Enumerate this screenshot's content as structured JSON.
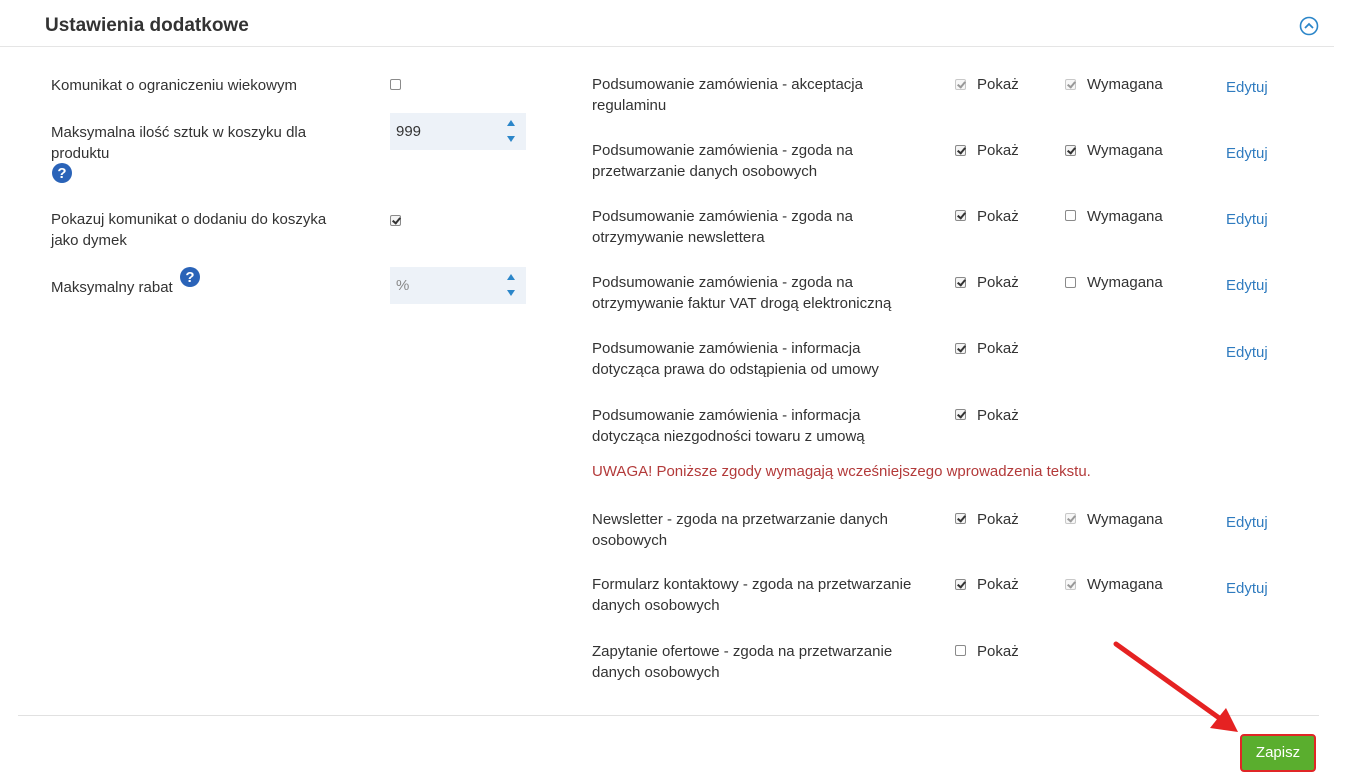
{
  "panel": {
    "title": "Ustawienia dodatkowe"
  },
  "left_settings": [
    {
      "label": "Komunikat o ograniczeniu wiekowym",
      "checked": false
    },
    {
      "label": "Maksymalna ilość sztuk w koszyku dla produktu",
      "value": "999"
    },
    {
      "label": "Pokazuj komunikat o dodaniu do koszyka jako dymek",
      "checked": true
    },
    {
      "label": "Maksymalny rabat",
      "placeholder": "%"
    }
  ],
  "consents": [
    {
      "text": "Podsumowanie zamówienia - akceptacja regulaminu",
      "show_label": "Pokaż",
      "show": true,
      "show_disabled": true,
      "required_label": "Wymagana",
      "required": true,
      "required_disabled": true,
      "edit": "Edytuj"
    },
    {
      "text": "Podsumowanie zamówienia - zgoda na przetwarzanie danych osobowych",
      "show_label": "Pokaż",
      "show": true,
      "required_label": "Wymagana",
      "required": true,
      "edit": "Edytuj"
    },
    {
      "text": "Podsumowanie zamówienia - zgoda na otrzymywanie newslettera",
      "show_label": "Pokaż",
      "show": true,
      "required_label": "Wymagana",
      "required": false,
      "edit": "Edytuj"
    },
    {
      "text": "Podsumowanie zamówienia - zgoda na otrzymywanie faktur VAT drogą elektroniczną",
      "show_label": "Pokaż",
      "show": true,
      "required_label": "Wymagana",
      "required": false,
      "edit": "Edytuj"
    },
    {
      "text": "Podsumowanie zamówienia - informacja dotycząca prawa do odstąpienia od umowy",
      "show_label": "Pokaż",
      "show": true,
      "edit": "Edytuj"
    },
    {
      "text": "Podsumowanie zamówienia - informacja dotycząca niezgodności towaru z umową",
      "show_label": "Pokaż",
      "show": true
    },
    {
      "text": "Newsletter - zgoda na przetwarzanie danych osobowych",
      "show_label": "Pokaż",
      "show": true,
      "required_label": "Wymagana",
      "required": true,
      "required_disabled": true,
      "edit": "Edytuj"
    },
    {
      "text": "Formularz kontaktowy - zgoda na przetwarzanie danych osobowych",
      "show_label": "Pokaż",
      "show": true,
      "required_label": "Wymagana",
      "required": true,
      "required_disabled": true,
      "edit": "Edytuj"
    },
    {
      "text": "Zapytanie ofertowe - zgoda na przetwarzanie danych osobowych",
      "show_label": "Pokaż",
      "show": false
    }
  ],
  "warning": "UWAGA! Poniższe zgody wymagają wcześniejszego wprowadzenia tekstu.",
  "save_label": "Zapisz",
  "colors": {
    "accent_link": "#2f7bbf",
    "warning": "#b33a3a",
    "save_button": "#5aae2e",
    "highlight": "#e02626"
  }
}
